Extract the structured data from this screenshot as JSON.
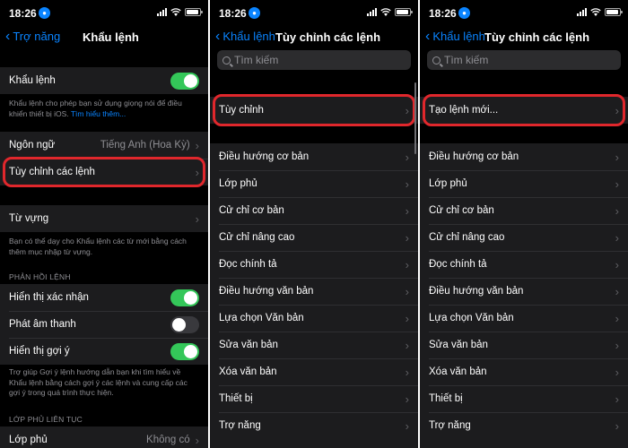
{
  "status": {
    "time": "18:26"
  },
  "panel1": {
    "back": "Trợ năng",
    "title": "Khẩu lệnh",
    "voice_control": {
      "label": "Khẩu lệnh",
      "on": true
    },
    "footer_text": "Khẩu lệnh cho phép bạn sử dụng giọng nói để điều khiển thiết bị iOS.",
    "footer_link": "Tìm hiểu thêm...",
    "language": {
      "label": "Ngôn ngữ",
      "value": "Tiếng Anh (Hoa Kỳ)"
    },
    "customize": {
      "label": "Tùy chỉnh các lệnh"
    },
    "vocabulary": {
      "label": "Từ vựng"
    },
    "vocabulary_footer": "Bạn có thể dạy cho Khẩu lệnh các từ mới bằng cách thêm mục nhập từ vựng.",
    "feedback_header": "PHẢN HỒI LỆNH",
    "show_confirmation": {
      "label": "Hiển thị xác nhận",
      "on": true
    },
    "play_sound": {
      "label": "Phát âm thanh",
      "on": false
    },
    "show_hints": {
      "label": "Hiển thị gợi ý",
      "on": true
    },
    "hints_footer": "Trợ giúp Gợi ý lệnh hướng dẫn bạn khi tìm hiểu về Khẩu lệnh bằng cách gợi ý các lệnh và cung cấp các gợi ý trong quá trình thực hiện.",
    "overlay_header": "LỚP PHỦ LIÊN TỤC",
    "overlay": {
      "label": "Lớp phủ",
      "value": "Không có"
    }
  },
  "panel2": {
    "back": "Khẩu lệnh",
    "title": "Tùy chỉnh các lệnh",
    "search_placeholder": "Tìm kiếm",
    "custom": "Tùy chỉnh",
    "items": [
      "Điều hướng cơ bản",
      "Lớp phủ",
      "Cử chỉ cơ bản",
      "Cử chỉ nâng cao",
      "Đọc chính tả",
      "Điều hướng văn bản",
      "Lựa chọn Văn bản",
      "Sửa văn bản",
      "Xóa văn bản",
      "Thiết bị",
      "Trợ năng"
    ]
  },
  "panel3": {
    "back": "Khẩu lệnh",
    "title": "Tùy chỉnh các lệnh",
    "search_placeholder": "Tìm kiếm",
    "create_new": "Tạo lệnh mới...",
    "items": [
      "Điều hướng cơ bản",
      "Lớp phủ",
      "Cử chỉ cơ bản",
      "Cử chỉ nâng cao",
      "Đọc chính tả",
      "Điều hướng văn bản",
      "Lựa chọn Văn bản",
      "Sửa văn bản",
      "Xóa văn bản",
      "Thiết bị",
      "Trợ năng"
    ]
  },
  "icons": {
    "back": "chevron-left-icon",
    "disclosure": "chevron-right-icon",
    "search": "search-icon",
    "mic": "microphone-icon"
  },
  "colors": {
    "accent": "#0a84ff",
    "toggle_on": "#34c759",
    "highlight": "#e0272c",
    "background": "#000000",
    "cell": "#1c1c1e"
  }
}
